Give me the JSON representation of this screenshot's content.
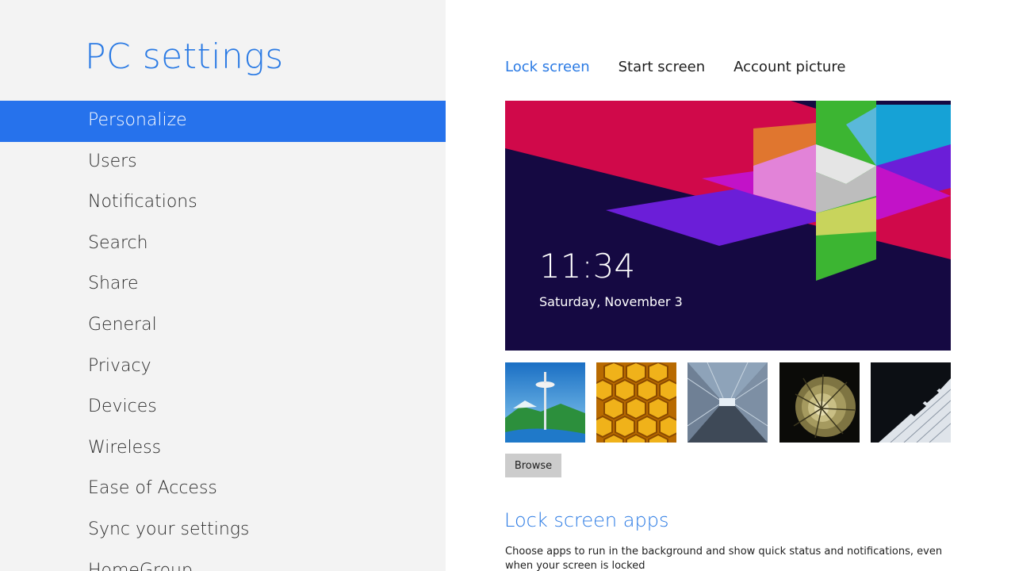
{
  "app": {
    "title": "PC settings"
  },
  "nav": {
    "items": [
      {
        "label": "Personalize",
        "selected": true
      },
      {
        "label": "Users"
      },
      {
        "label": "Notifications"
      },
      {
        "label": "Search"
      },
      {
        "label": "Share"
      },
      {
        "label": "General"
      },
      {
        "label": "Privacy"
      },
      {
        "label": "Devices"
      },
      {
        "label": "Wireless"
      },
      {
        "label": "Ease of Access"
      },
      {
        "label": "Sync your settings"
      },
      {
        "label": "HomeGroup"
      }
    ]
  },
  "tabs": [
    {
      "label": "Lock screen",
      "active": true
    },
    {
      "label": "Start screen"
    },
    {
      "label": "Account picture"
    }
  ],
  "lock_screen": {
    "time": "11:34",
    "date": "Saturday, November 3"
  },
  "thumbnails": [
    {
      "name": "space-needle-image"
    },
    {
      "name": "honeycomb-image"
    },
    {
      "name": "tunnel-image"
    },
    {
      "name": "nautilus-shell-image"
    },
    {
      "name": "piano-keys-image"
    }
  ],
  "browse_label": "Browse",
  "lock_apps": {
    "title": "Lock screen apps",
    "description": "Choose apps to run in the background and show quick status and notifications, even when your screen is locked"
  },
  "colors": {
    "accent": "#2672ec",
    "title_blue": "#2a7ae4",
    "left_pane_bg": "#f3f3f3",
    "lock_bg": "#150942"
  }
}
